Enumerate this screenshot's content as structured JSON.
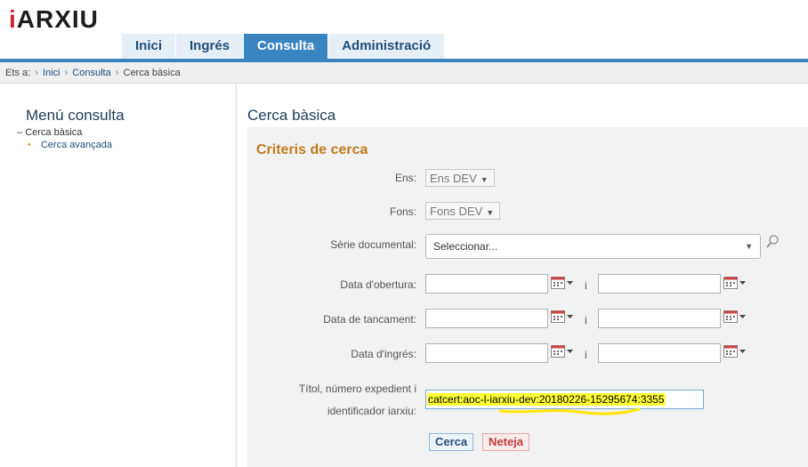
{
  "header": {
    "logo_i": "i",
    "logo_rest": "ARXIU"
  },
  "nav": {
    "tabs": [
      {
        "label": "Inici"
      },
      {
        "label": "Ingrés"
      },
      {
        "label": "Consulta",
        "active": true
      },
      {
        "label": "Administració"
      }
    ]
  },
  "breadcrumb": {
    "prefix": "Ets a:",
    "items": [
      "Inici",
      "Consulta",
      "Cerca bàsica"
    ]
  },
  "sidebar": {
    "title": "Menú consulta",
    "items": [
      {
        "label": "Cerca bàsica",
        "marker": "–"
      },
      {
        "label": "Cerca avançada",
        "marker": "•"
      }
    ]
  },
  "main": {
    "title": "Cerca bàsica",
    "section_title": "Criteris de cerca",
    "fields": {
      "ens": {
        "label": "Ens:",
        "value": "Ens DEV"
      },
      "fons": {
        "label": "Fons:",
        "value": "Fons DEV"
      },
      "serie": {
        "label": "Sèrie documental:",
        "value": "Seleccionar..."
      },
      "data_obertura": {
        "label": "Data d'obertura:",
        "from": "",
        "to": ""
      },
      "data_tancament": {
        "label": "Data de tancament:",
        "from": "",
        "to": ""
      },
      "data_ingres": {
        "label": "Data d'ingrés:",
        "from": "",
        "to": ""
      },
      "range_separator": "i",
      "titol": {
        "label_line1": "Títol, número expedient i",
        "label_line2": "identificador iarxiu:",
        "value": "catcert:aoc-l-iarxiu-dev:20180226-15295674:3355"
      }
    },
    "buttons": {
      "search": "Cerca",
      "clear": "Neteja"
    }
  },
  "colors": {
    "brand_red": "#d01f2e",
    "nav_active": "#3a84bf",
    "section_orange": "#c07a1e",
    "highlight_yellow": "#ffff33"
  }
}
